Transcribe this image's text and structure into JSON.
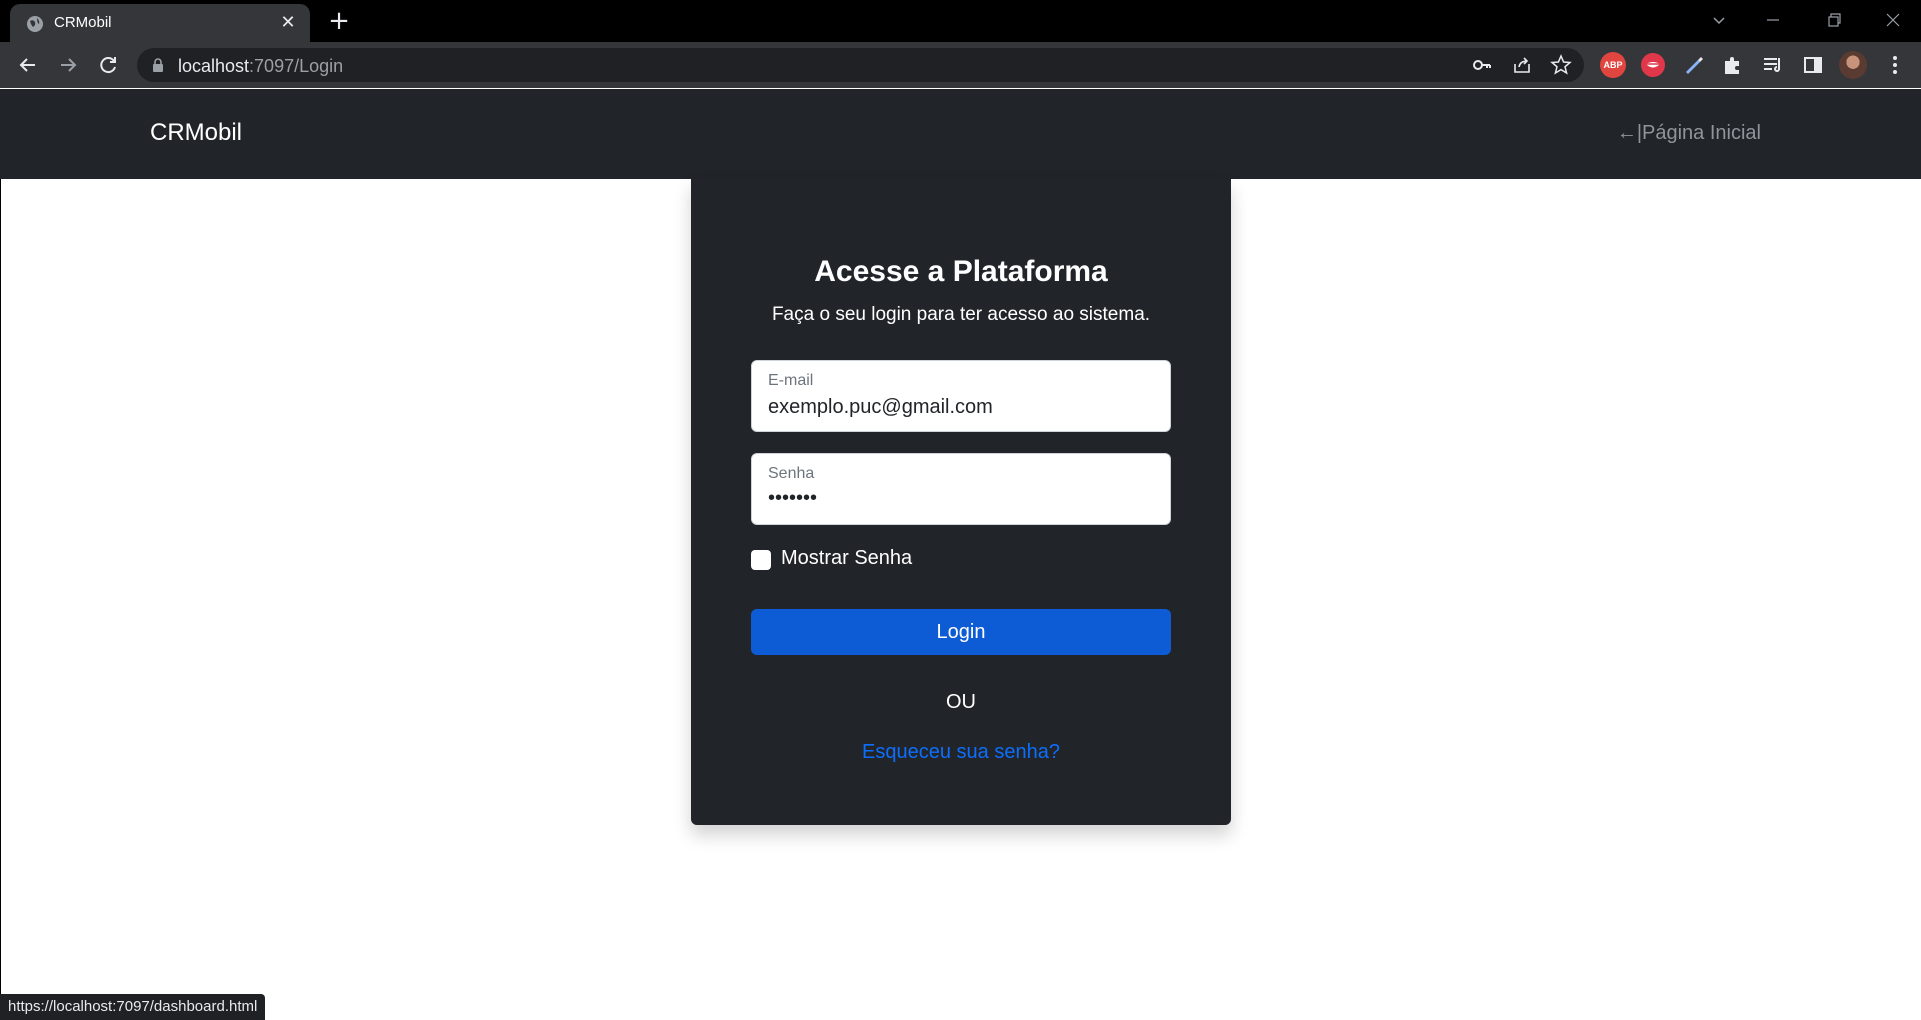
{
  "browser": {
    "tab_title": "CRMobil",
    "new_tab": "+",
    "close_tab": "✕",
    "url_host": "localhost",
    "url_path": ":7097/Login",
    "extensions": [
      "key-icon",
      "share-icon",
      "star-icon",
      "abp-icon",
      "lips-icon",
      "pen-icon",
      "puzzle-icon",
      "playlist-icon",
      "sidepanel-icon",
      "avatar",
      "menu-icon"
    ],
    "abp_label": "ABP",
    "status_url": "https://localhost:7097/dashboard.html"
  },
  "navbar": {
    "brand": "CRMobil",
    "home_link": "←|Página Inicial"
  },
  "login": {
    "title": "Acesse a Plataforma",
    "subtitle": "Faça o seu login para ter acesso ao sistema.",
    "email_label": "E-mail",
    "email_value": "exemplo.puc@gmail.com",
    "password_label": "Senha",
    "password_value": "•••••••",
    "show_password_label": "Mostrar Senha",
    "show_password_checked": false,
    "login_button": "Login",
    "or_text": "OU",
    "forgot_link": "Esqueceu sua senha?"
  },
  "colors": {
    "navbar_bg": "#212529",
    "card_bg": "#212529",
    "primary": "#0d5cd6",
    "link": "#0d6efd"
  }
}
